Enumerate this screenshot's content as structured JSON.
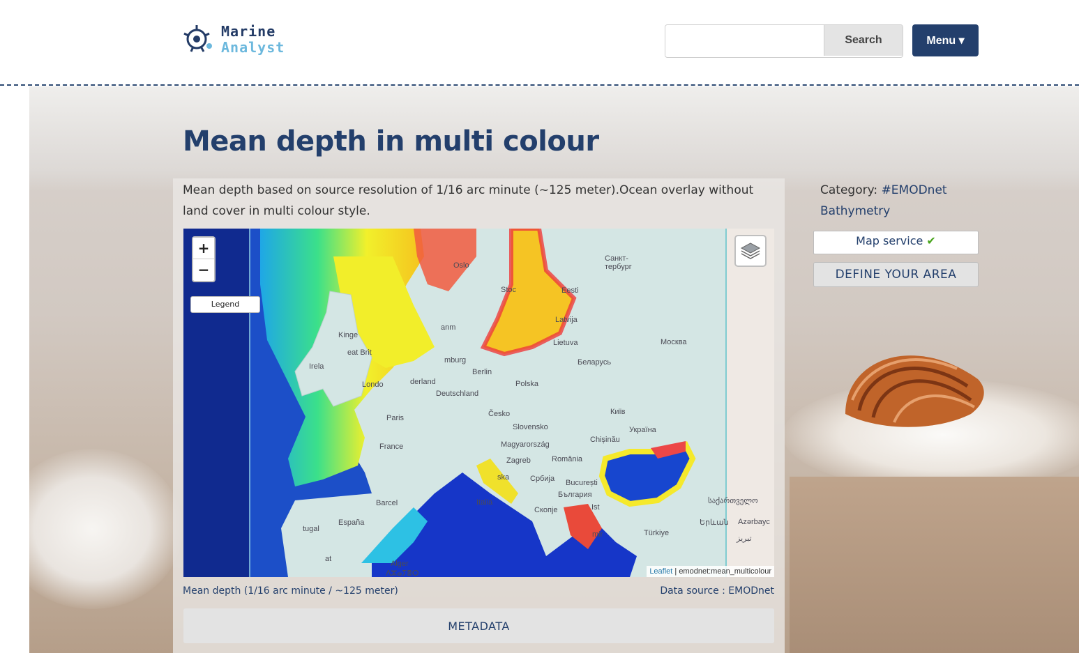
{
  "header": {
    "logo_line1": "Marine",
    "logo_line2": "Analyst",
    "search_placeholder": "",
    "search_label": "Search",
    "menu_label": "Menu ▾"
  },
  "page": {
    "title": "Mean depth in multi colour",
    "description": "Mean depth based on source resolution of 1/16 arc minute (~125 meter).Ocean overlay without land cover in multi colour style."
  },
  "map": {
    "zoom_in": "+",
    "zoom_out": "−",
    "legend_label": "Legend",
    "attribution_link": "Leaflet",
    "attribution_text": " | emodnet:mean_multicolour",
    "place_labels": {
      "oslo": "Oslo",
      "stockholm": "Stoc",
      "st_petersburg_1": "Санкт-",
      "st_petersburg_2": "тербург",
      "eesti": "Eesti",
      "latvija": "Latvija",
      "lietuva": "Lietuva",
      "moskva": "Москва",
      "belarus": "Беларусь",
      "kingdom": "Kinge",
      "irela": "Irela",
      "great_brit": "eat Brit",
      "danm": "anm",
      "hamburg": "mburg",
      "london": "Londo",
      "nederland": "derland",
      "berlin": "Berlin",
      "polska": "Polska",
      "deutschland": "Deutschland",
      "kyiv": "Київ",
      "paris": "Paris",
      "cesko": "Česko",
      "slovensko": "Slovensko",
      "ukraina": "Україна",
      "france": "France",
      "chisinau": "Chișinău",
      "magyarorszag": "Magyarország",
      "zagreb": "Zagreb",
      "romania": "România",
      "hrvatska": "ska",
      "srbija": "Србија",
      "bucuresti": "București",
      "bulgaria": "България",
      "sakartvelo": "საქართველო",
      "barcelona": "Barcel",
      "italia": "Italia",
      "skopje": "Скопје",
      "istanbul": "Ist",
      "yerevan": "Երևան",
      "azerbaycan": "Azərbayc",
      "espana": "España",
      "portugal": "tugal",
      "izmir": "mir",
      "turkiye": "Türkiye",
      "tabriz": "تبریز",
      "alger": "Alger",
      "tamazight": "ⴷⵣⴰⵢⴻⵔ",
      "rabat": "at"
    }
  },
  "captions": {
    "left": "Mean depth (1/16 arc minute / ~125 meter)",
    "right": "Data source : EMODnet"
  },
  "metadata_label": "METADATA",
  "sidebar": {
    "category_prefix": "Category: ",
    "category_link": "#EMODnet Bathymetry",
    "map_service_label": "Map service ",
    "map_service_check": "✔",
    "define_area_label": "DEFINE YOUR AREA"
  }
}
